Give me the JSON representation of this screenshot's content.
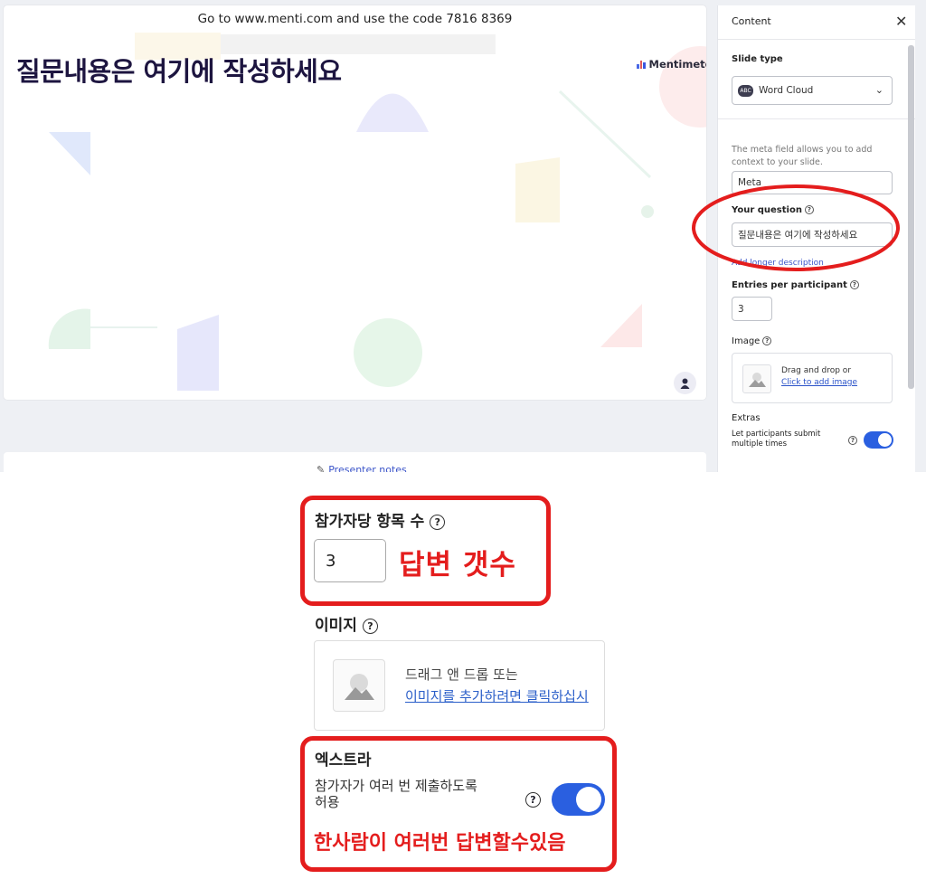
{
  "slide": {
    "join_text": "Go to www.menti.com and use the code 7816 8369",
    "title": "질문내용은 여기에 작성하세요",
    "brand": "Mentimeter"
  },
  "notes": {
    "label": "Presenter notes"
  },
  "panel": {
    "header": "Content",
    "slide_type_label": "Slide type",
    "slide_type_value": "Word Cloud",
    "meta_help": "The meta field allows you to add context to your slide.",
    "meta_value": "Meta",
    "question_label": "Your question",
    "question_value": "질문내용은 여기에 작성하세요",
    "longer_desc": "Add longer description",
    "entries_label": "Entries per participant",
    "entries_value": "3",
    "image_label": "Image",
    "drag_text": "Drag and drop or",
    "click_text": "Click to add image",
    "extras_label": "Extras",
    "multi_submit": "Let participants submit multiple times",
    "multi_enabled": true
  },
  "zoom": {
    "entries_label": "참가자당 항목 수",
    "entries_value": "3",
    "entries_note": "답변 갯수",
    "image_label": "이미지",
    "drag_text": "드래그 앤 드롭 또는",
    "click_text": "이미지를 추가하려면 클릭하십시",
    "extras_label": "엑스트라",
    "multi_line1": "참가자가 여러 번 제출하도록",
    "multi_line2": "허용",
    "multi_note": "한사람이 여러번 답변할수있음"
  },
  "colors": {
    "accent": "#2a5fe0",
    "annotation": "#e41d1d",
    "title": "#1d1540"
  }
}
